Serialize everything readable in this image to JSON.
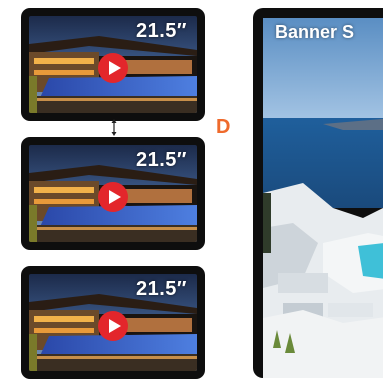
{
  "screens": [
    {
      "size_label": "21.5″"
    },
    {
      "size_label": "21.5″"
    },
    {
      "size_label": "21.5″"
    }
  ],
  "model_letter": "D",
  "banner": {
    "title": "Banner S"
  },
  "colors": {
    "accent_orange": "#ef6a2c",
    "play_red": "#e3262b",
    "bezel": "#0e0e0e"
  },
  "icons": {
    "play": "play-icon",
    "arrow": "vertical-double-arrow-icon"
  }
}
